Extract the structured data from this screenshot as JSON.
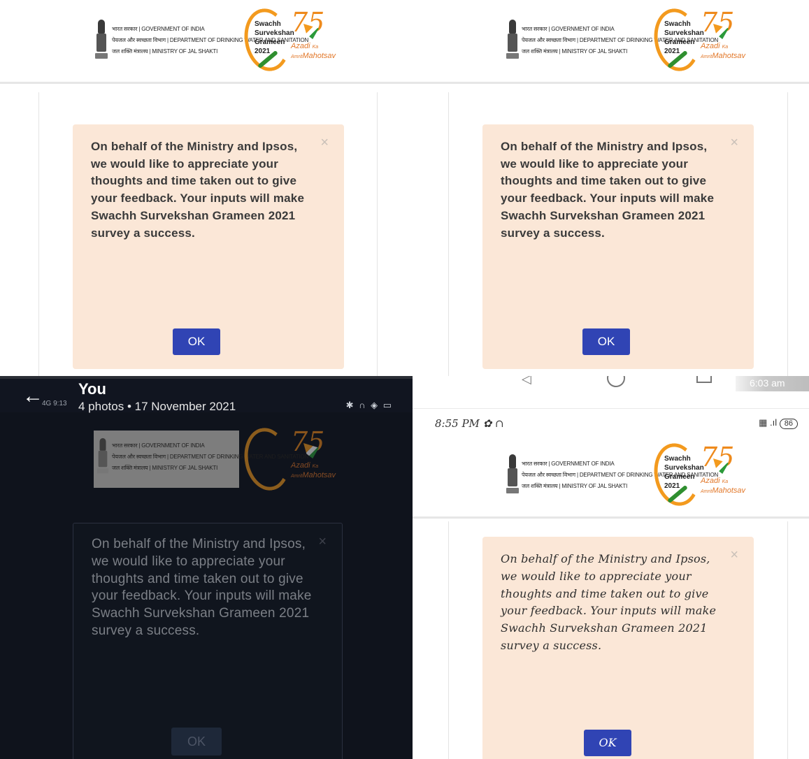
{
  "logo": {
    "gov_lines": [
      "भारत सरकार | GOVERNMENT OF INDIA",
      "पेयजल और स्वच्छता विभाग | DEPARTMENT OF DRINKING WATER AND SANITATION",
      "जल शक्ति मंत्रालय | MINISTRY OF JAL SHAKTI"
    ],
    "ss_lines": [
      "Swachh",
      "Survekshan",
      "Grameen 2021"
    ],
    "azadi_75": "75",
    "azadi_lines": [
      "Azadi",
      "Ka",
      "Amrit",
      "Mahotsav"
    ]
  },
  "message": "On behalf of the Ministry and Ipsos, we would like to appreciate your thoughts and time taken out to give your feedback. Your inputs will make Swachh Survekshan Grameen 2021 survey a success.",
  "close_symbol": "×",
  "ok_label": "OK",
  "ok_label_script": "OK",
  "gallery": {
    "title": "You",
    "subtitle": "4 photos  •  17 November 2021",
    "ghost_status": "4G  9:13",
    "status_icons": "✱ ∩ ◈ ▭"
  },
  "q4": {
    "time_chip": "6:03 am",
    "phone_time": "8:55 PM",
    "battery": "86",
    "signal": "▦ .ıl"
  },
  "icons": {
    "back": "arrow-left-icon",
    "nav_back": "nav-back-icon",
    "nav_home": "nav-home-icon",
    "nav_recents": "nav-recents-icon"
  }
}
